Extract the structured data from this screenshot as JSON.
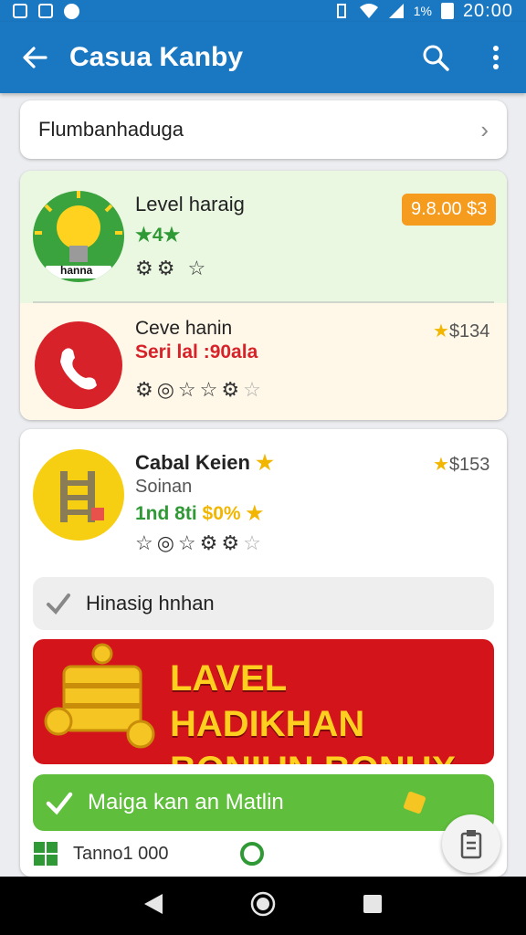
{
  "status_bar": {
    "battery": "1%",
    "time": "20:00"
  },
  "app_bar": {
    "title": "Casua Kanby"
  },
  "search_row": {
    "label": "Flumbanhaduga"
  },
  "item1": {
    "title": "Level haraig",
    "rank": "★4★",
    "badge_text": "hanna",
    "price": "9.8.00 $3"
  },
  "item2": {
    "title": "Ceve hanin",
    "subtitle": "Seri lal :90ala",
    "price": "$134"
  },
  "item3": {
    "title": "Cabal Keien",
    "subtitle": "Soinan",
    "offer_prefix": "1nd 8ti",
    "offer_value": "$0%",
    "price": "$153"
  },
  "hint_row": {
    "label": "Hinasig hnhan"
  },
  "banner": {
    "line1": "LAVEL HADIKHAN",
    "line2": "BONIUN BONUX"
  },
  "green_row": {
    "label": "Maiga kan an Matlin"
  },
  "bottom_strip": {
    "text": "Tanno1 000"
  },
  "colors": {
    "primary": "#1a78c2",
    "accent": "#f59b1d",
    "banner": "#d4141b",
    "green": "#5fbe3c"
  }
}
